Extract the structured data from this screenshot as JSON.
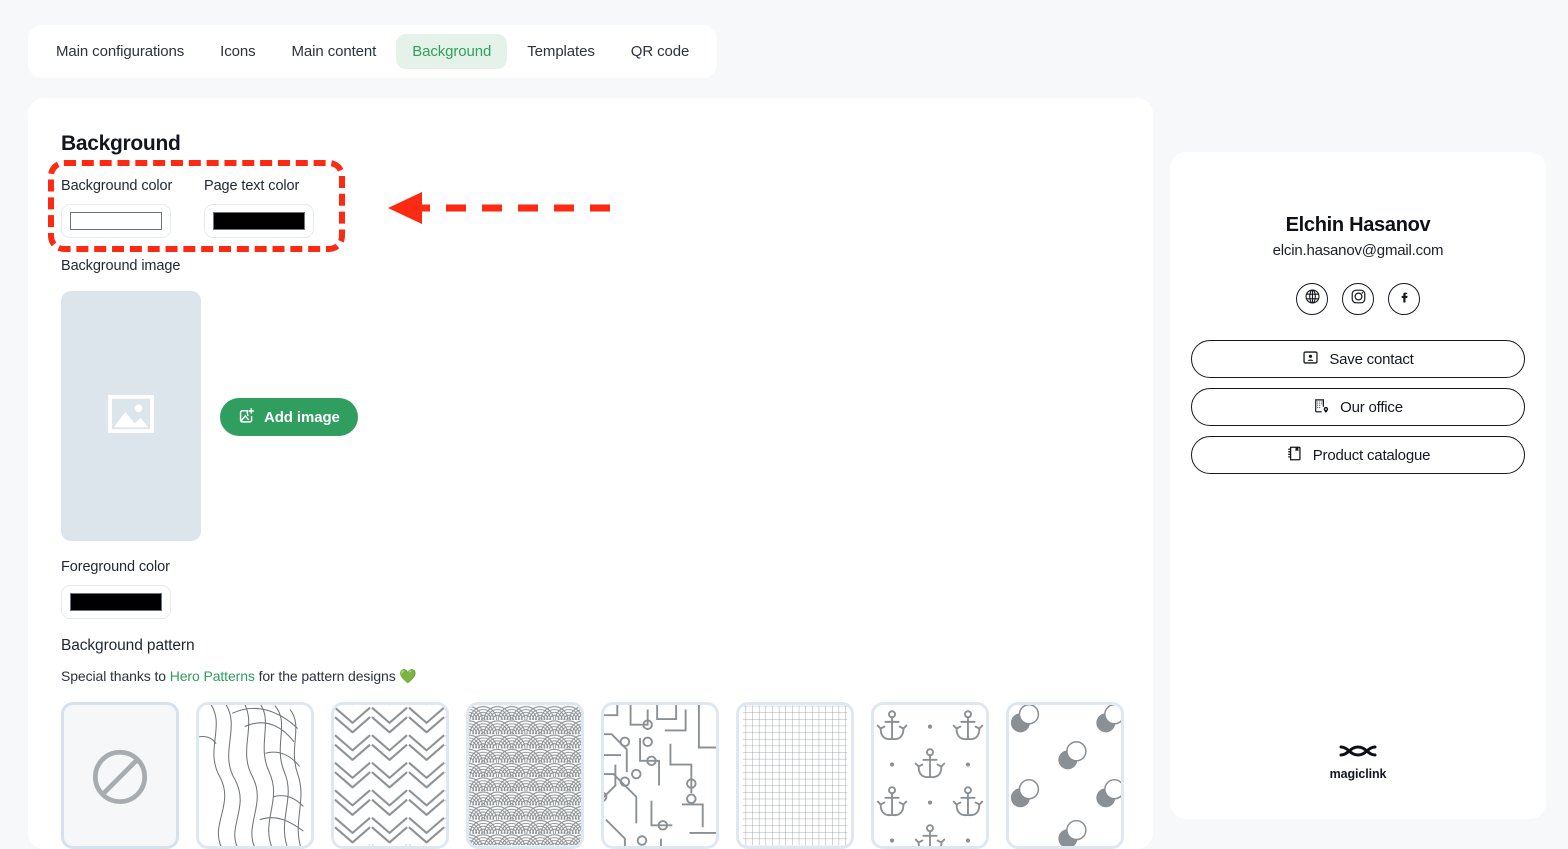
{
  "tabs": [
    {
      "label": "Main configurations",
      "active": false
    },
    {
      "label": "Icons",
      "active": false
    },
    {
      "label": "Main content",
      "active": false
    },
    {
      "label": "Background",
      "active": true
    },
    {
      "label": "Templates",
      "active": false
    },
    {
      "label": "QR code",
      "active": false
    }
  ],
  "editor": {
    "section_title": "Background",
    "background_color_label": "Background color",
    "background_color_value": "#FFFFFF",
    "page_text_color_label": "Page text color",
    "page_text_color_value": "#000000",
    "background_image_label": "Background image",
    "image_placeholder_icon": "image-icon",
    "add_image_label": "Add image",
    "add_image_icon": "add-image-icon",
    "foreground_color_label": "Foreground color",
    "foreground_color_value": "#000000",
    "background_pattern_label": "Background pattern",
    "thanks_prefix": "Special thanks to ",
    "thanks_link": "Hero Patterns",
    "thanks_suffix": " for the pattern designs ",
    "thanks_emoji": "💚",
    "patterns": [
      {
        "name": "none",
        "selected": true,
        "icon": "no-pattern-icon"
      },
      {
        "name": "topography",
        "selected": false
      },
      {
        "name": "chevron",
        "selected": false
      },
      {
        "name": "japanese-waves",
        "selected": false
      },
      {
        "name": "circuit-board",
        "selected": false
      },
      {
        "name": "graph-paper",
        "selected": false
      },
      {
        "name": "anchors",
        "selected": false
      },
      {
        "name": "bubbles",
        "selected": false
      }
    ]
  },
  "preview": {
    "name": "Elchin Hasanov",
    "email": "elcin.hasanov@gmail.com",
    "socials": [
      {
        "name": "website",
        "icon": "globe-icon"
      },
      {
        "name": "instagram",
        "icon": "instagram-icon"
      },
      {
        "name": "facebook",
        "icon": "facebook-icon"
      }
    ],
    "buttons": [
      {
        "label": "Save contact",
        "icon": "contact-card-icon"
      },
      {
        "label": "Our office",
        "icon": "building-pin-icon"
      },
      {
        "label": "Product catalogue",
        "icon": "notebook-icon"
      }
    ],
    "footer_brand": "magiclink",
    "footer_logo_icon": "magiclink-logo-icon"
  },
  "annotation": {
    "color": "#FC2A12",
    "shape": "dashed-rounded-box-with-left-arrow",
    "target": "background-color-and-page-text-color-pickers"
  },
  "colors": {
    "accent_green": "#2F9E5F",
    "active_tab_bg": "#E5F2EA",
    "page_bg": "#F7F8FA",
    "card_bg": "#FFFFFF",
    "drop_zone": "#DDE5EC",
    "annotation_red": "#FC2A12"
  }
}
